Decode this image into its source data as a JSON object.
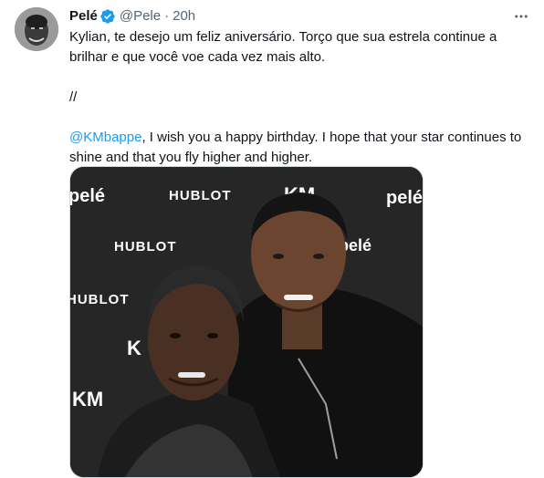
{
  "tweet": {
    "author_name": "Pelé",
    "handle": "@Pele",
    "separator": "·",
    "time": "20h",
    "text_pt_line1": "Kylian, te desejo um feliz aniversário. Torço que sua estrela continue a",
    "text_pt_line2": "brilhar e que você voe cada vez mais alto.",
    "divider": "//",
    "mention": "@KMbappe",
    "text_en_line1_rest": ", I wish you a happy birthday. I hope that your star continues to",
    "text_en_line2": "shine and that you fly higher and higher."
  },
  "media": {
    "backdrop_logos": [
      "pelé",
      "HUBLOT",
      "KM",
      "pelé",
      "HUBLOT",
      "pelé",
      "HUBLOT",
      "K",
      "KM"
    ]
  },
  "icons": {
    "verified": "verified-badge-icon",
    "more": "more-options-icon"
  },
  "colors": {
    "accent": "#1d9bf0",
    "secondary_text": "#536471",
    "primary_text": "#0f1419"
  }
}
